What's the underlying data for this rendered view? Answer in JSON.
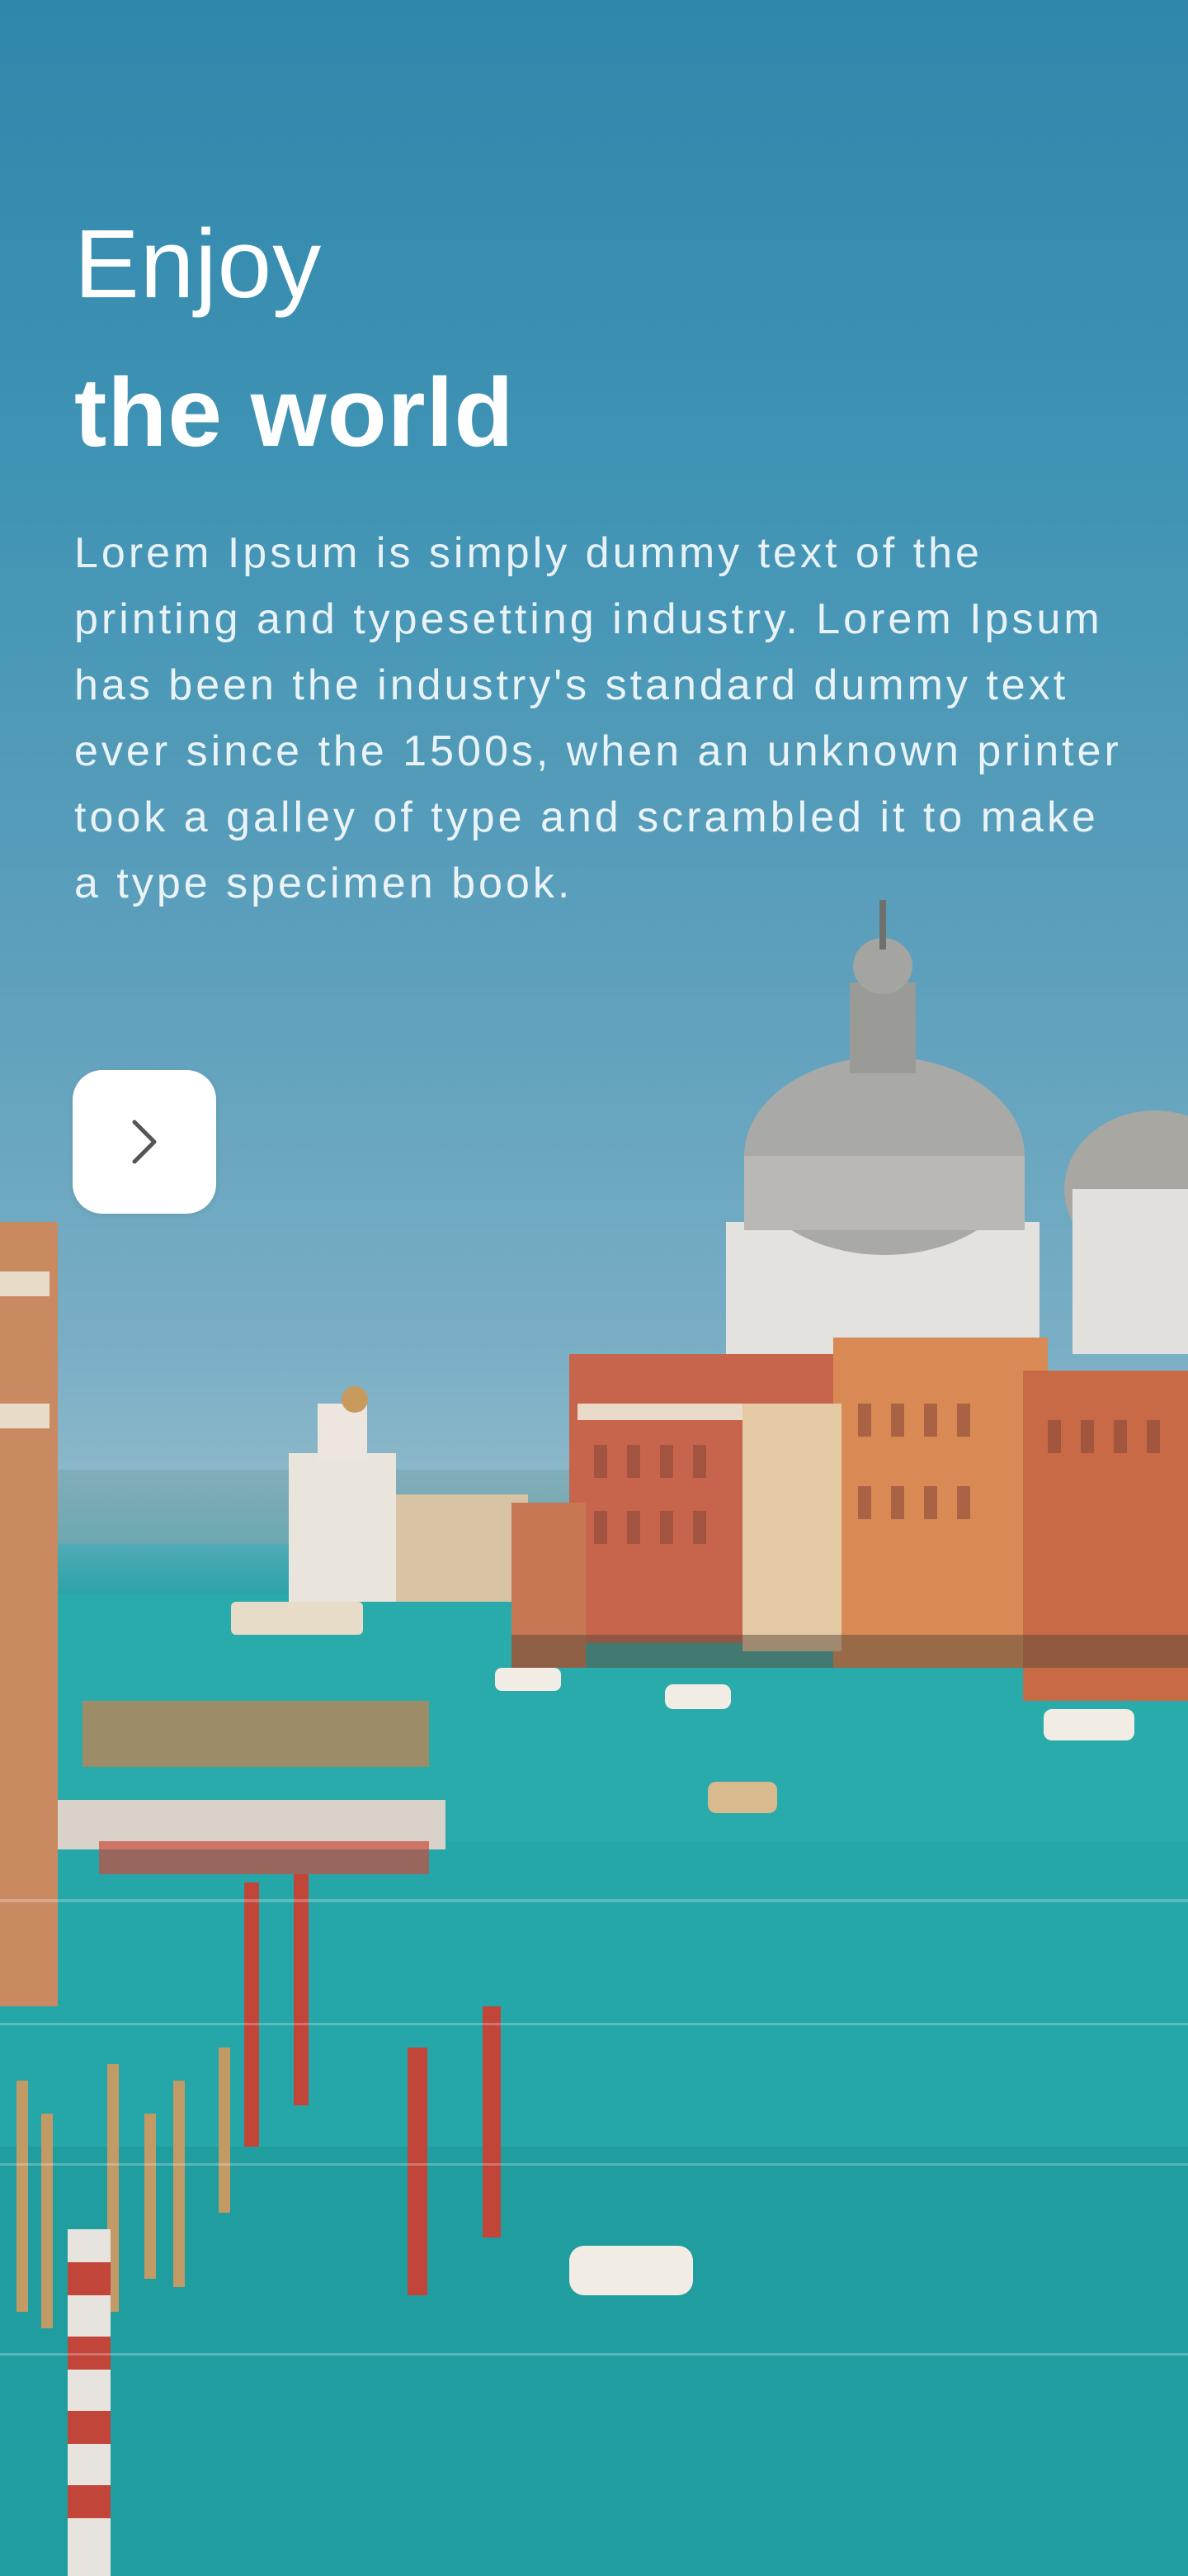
{
  "hero": {
    "title_line1": "Enjoy",
    "title_line2": "the world",
    "description": "Lorem Ipsum is simply dummy text of the printing and typesetting industry. Lorem Ipsum has been the industry's standard dummy text ever since the 1500s, when an unknown printer took a galley of type and scrambled it to make a type specimen book."
  },
  "next_button": {
    "icon": "chevron-right-icon"
  },
  "colors": {
    "sky_top": "#2f87ab",
    "water": "#23a7a7",
    "title_text": "#ffffff",
    "button_bg": "#ffffff",
    "button_icon": "#555555"
  }
}
